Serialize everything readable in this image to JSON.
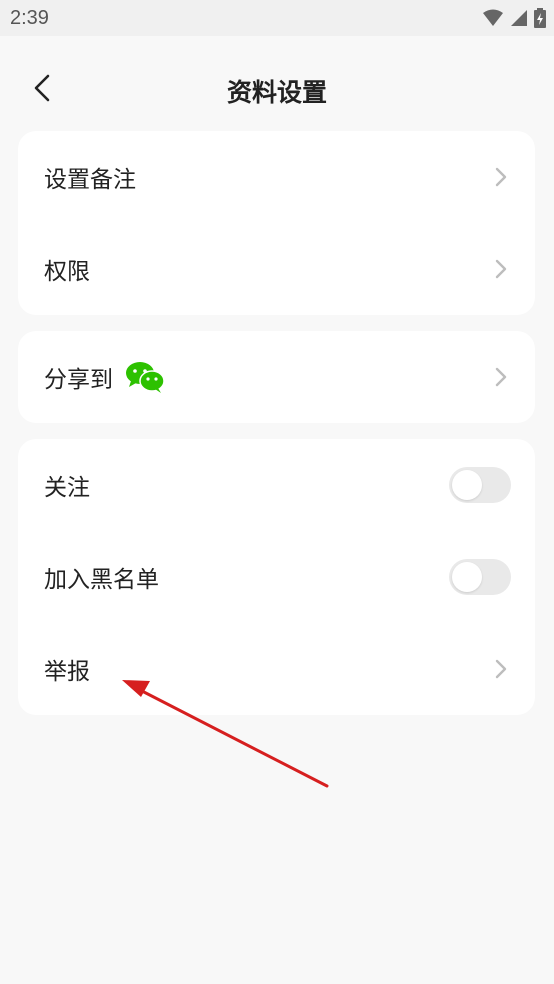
{
  "status_bar": {
    "time": "2:39"
  },
  "header": {
    "title": "资料设置"
  },
  "groups": {
    "group1": [
      {
        "label": "设置备注"
      },
      {
        "label": "权限"
      }
    ],
    "group2": {
      "share_label": "分享到",
      "share_icon": "wechat-icon"
    },
    "group3": {
      "follow": {
        "label": "关注",
        "on": false
      },
      "blacklist": {
        "label": "加入黑名单",
        "on": false
      },
      "report": {
        "label": "举报"
      }
    }
  },
  "colors": {
    "background": "#f8f8f8",
    "card": "#ffffff",
    "toggle_off": "#e9e9e9",
    "wechat_green": "#2dc100",
    "annotation_arrow": "#d61f1f"
  }
}
